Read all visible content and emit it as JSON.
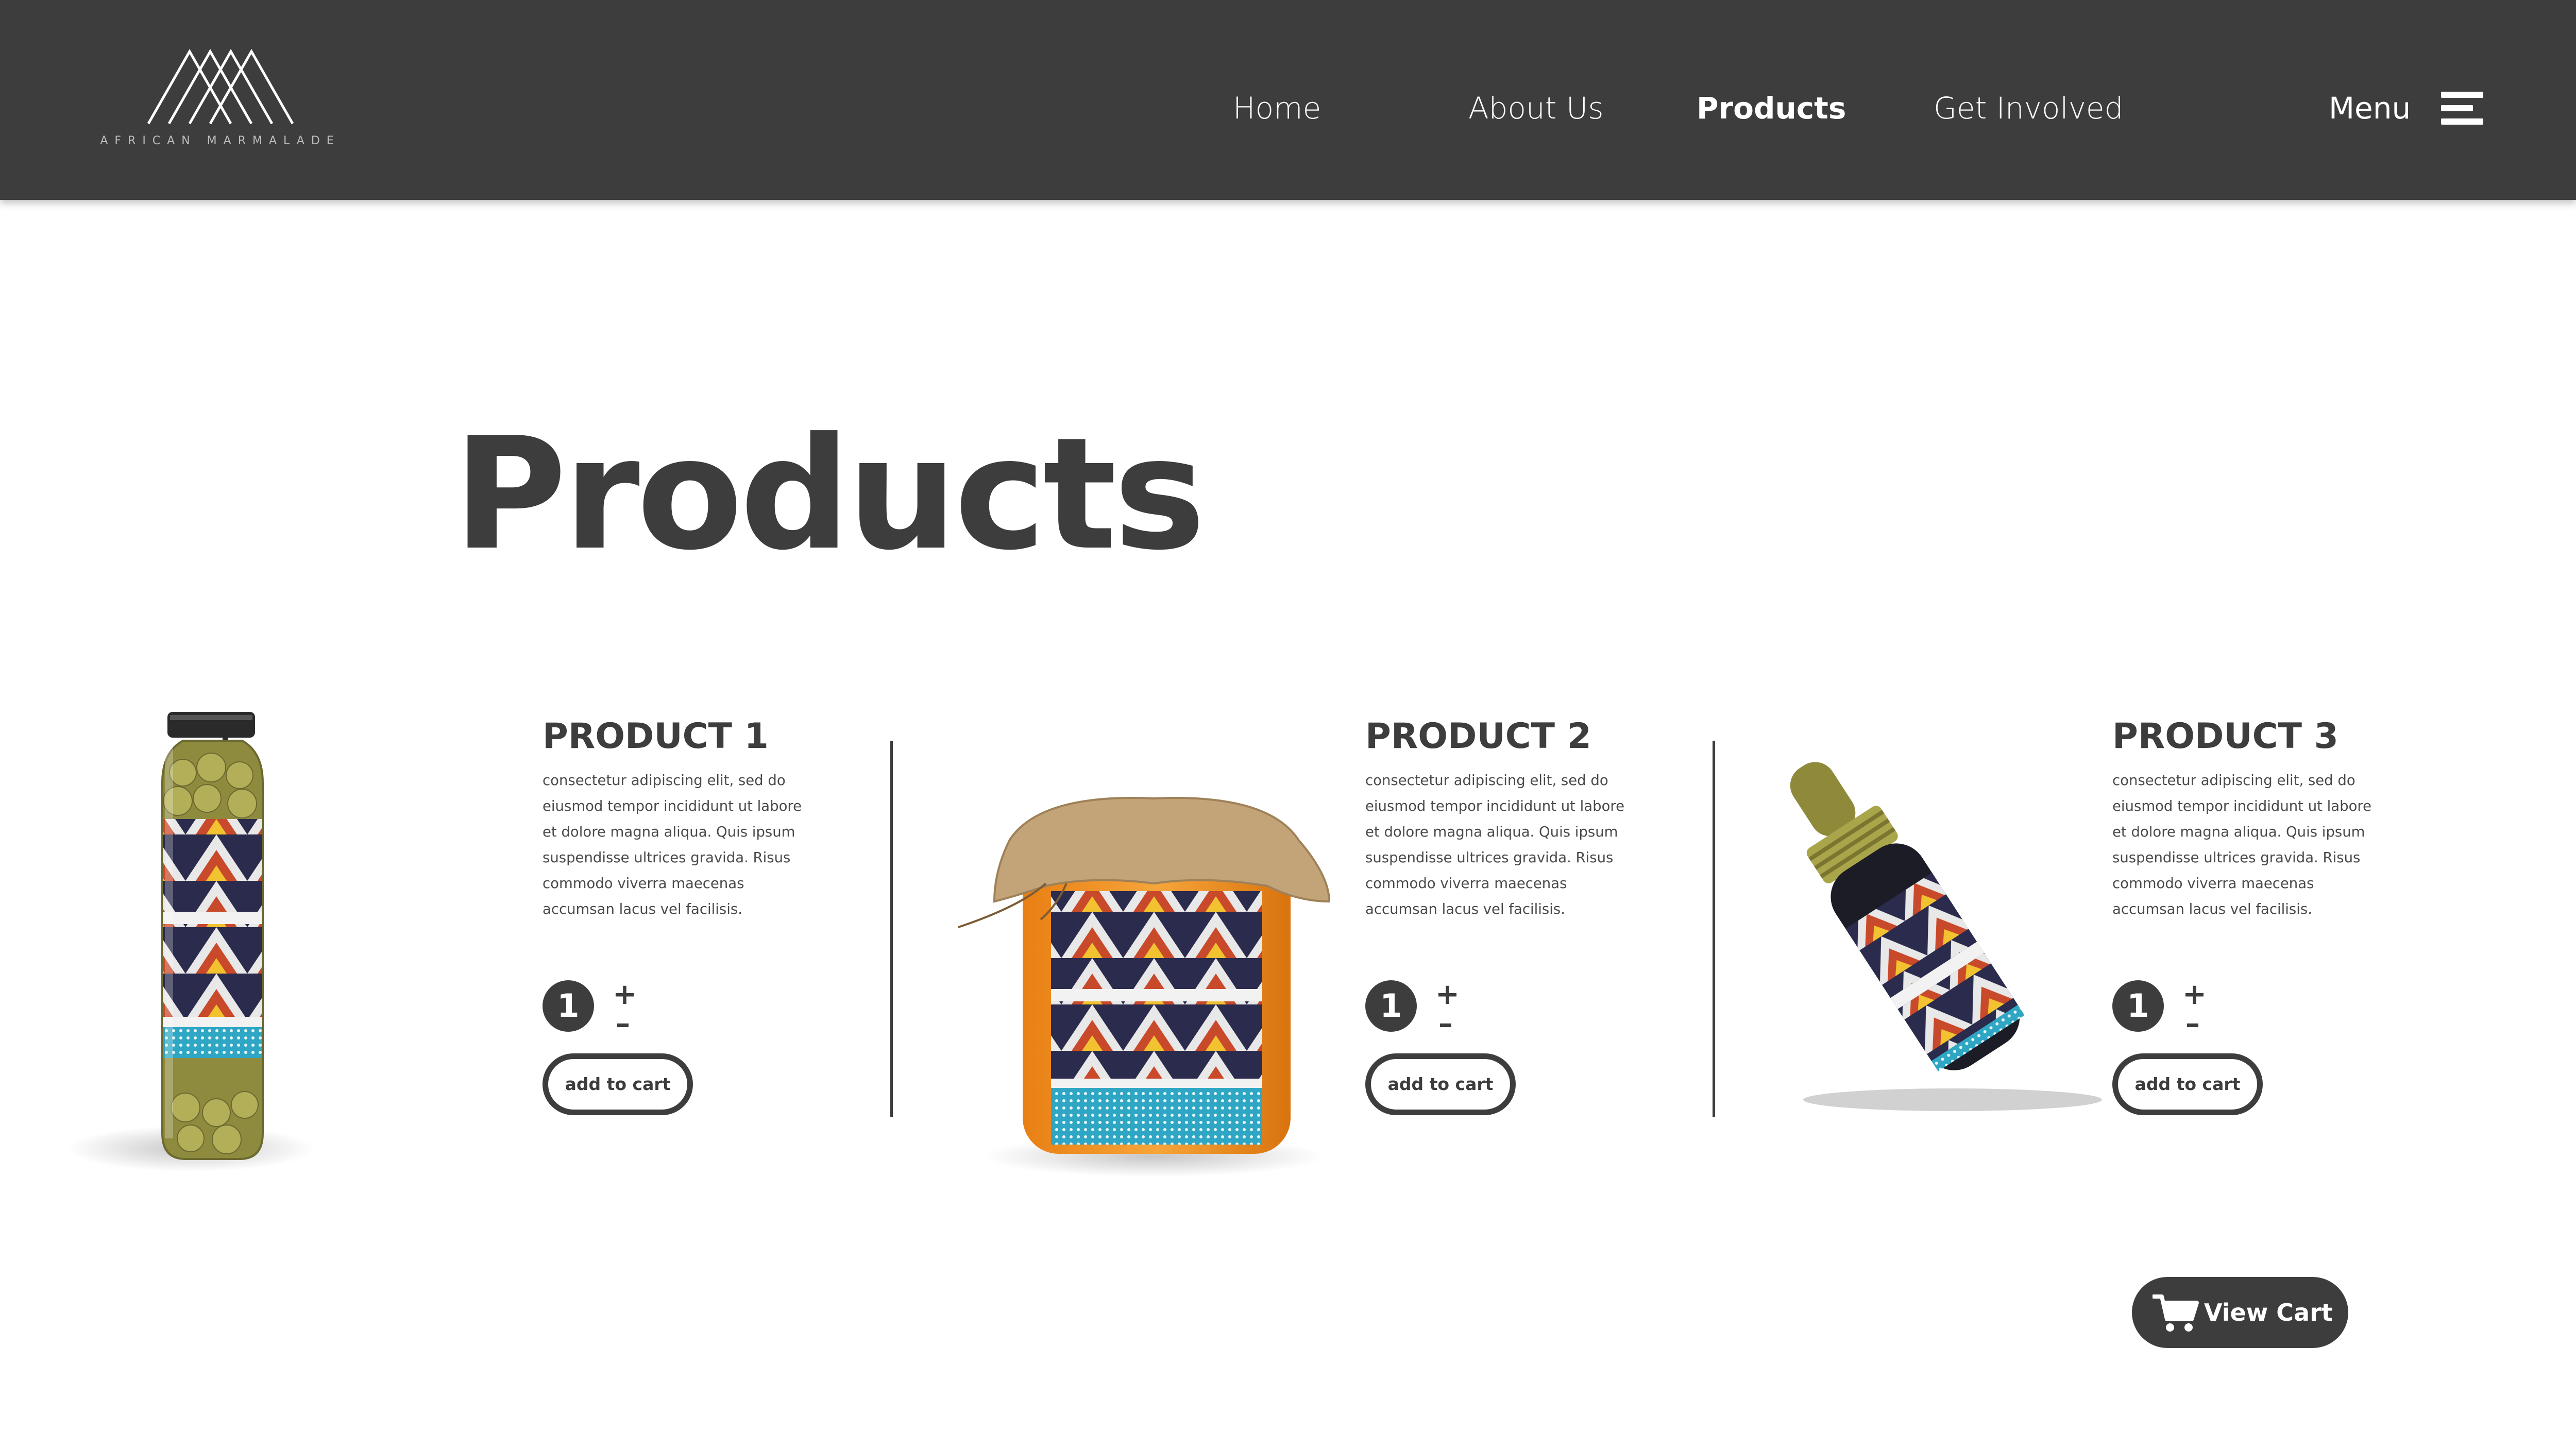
{
  "brand": {
    "logo_text": "AFRICAN MARMALADE"
  },
  "nav": {
    "items": [
      {
        "label": "Home",
        "active": false
      },
      {
        "label": "About Us",
        "active": false
      },
      {
        "label": "Products",
        "active": true
      },
      {
        "label": "Get Involved",
        "active": false
      }
    ],
    "menu_label": "Menu",
    "menu_icon": "hamburger-icon"
  },
  "page": {
    "title": "Products"
  },
  "products": [
    {
      "name": "PRODUCT 1",
      "description": "consectetur adipiscing elit, sed do eiusmod tempor incididunt ut labore et dolore magna aliqua. Quis ipsum suspendisse ultrices gravida. Risus commodo viverra maecenas accumsan lacus vel facilisis.",
      "quantity": "1",
      "plus": "+",
      "minus": "–",
      "add_to_cart": "add to cart",
      "image": "olive-jar"
    },
    {
      "name": "PRODUCT 2",
      "description": "consectetur adipiscing elit, sed do eiusmod tempor incididunt ut labore et dolore magna aliqua. Quis ipsum suspendisse ultrices gravida. Risus commodo viverra maecenas accumsan lacus vel facilisis.",
      "quantity": "1",
      "plus": "+",
      "minus": "–",
      "add_to_cart": "add to cart",
      "image": "honey-jar"
    },
    {
      "name": "PRODUCT 3",
      "description": "consectetur adipiscing elit, sed do eiusmod tempor incididunt ut labore et dolore magna aliqua. Quis ipsum suspendisse ultrices gravida. Risus commodo viverra maecenas accumsan lacus vel facilisis.",
      "quantity": "1",
      "plus": "+",
      "minus": "–",
      "add_to_cart": "add to cart",
      "image": "dropper-bottle"
    }
  ],
  "cart": {
    "label": "View Cart",
    "icon": "shopping-cart-icon"
  },
  "colors": {
    "header": "#3d3d3d",
    "text": "#3d3d3d",
    "background": "#ffffff"
  }
}
